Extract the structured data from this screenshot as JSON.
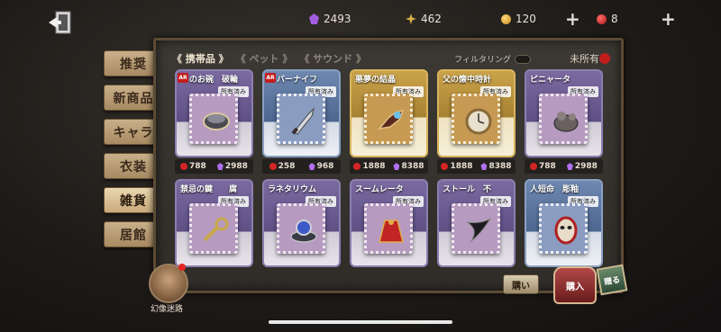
{
  "topbar": {
    "gems": "2493",
    "clues": "462",
    "coins": "120",
    "fragments": "8",
    "plus": "+"
  },
  "side_tabs": [
    "推奨",
    "新商品",
    "キャラ",
    "衣装",
    "雑貨",
    "居館"
  ],
  "active_side_tab": 4,
  "panel": {
    "cat_tabs": [
      "《 携帯品 》",
      "《 ペット 》",
      "《 サウンド 》"
    ],
    "active_cat_tab": 0,
    "filter_label": "フィルタリング",
    "unowned_label": "未所有"
  },
  "items": [
    {
      "name": "のお碗　破輪",
      "owned": "所有済み",
      "red": "788",
      "purple": "2988",
      "ar": "AR",
      "rarity": "purple"
    },
    {
      "name": "バーナイフ",
      "owned": "所有済み",
      "red": "258",
      "purple": "968",
      "ar": "AR",
      "rarity": "blue"
    },
    {
      "name": "悪夢の結晶",
      "owned": "所有済み",
      "red": "1888",
      "purple": "8388",
      "ar": "",
      "rarity": "gold"
    },
    {
      "name": "父の懐中時計",
      "owned": "所有済み",
      "red": "1888",
      "purple": "8388",
      "ar": "",
      "rarity": "gold"
    },
    {
      "name": "ピニャータ",
      "owned": "所有済み",
      "red": "788",
      "purple": "2988",
      "ar": "",
      "rarity": "purple"
    },
    {
      "name": "禁忌の鍵　　腐",
      "owned": "所有済み",
      "red": "",
      "purple": "",
      "ar": "",
      "rarity": "purple"
    },
    {
      "name": "ラネタリウム",
      "owned": "所有済み",
      "red": "",
      "purple": "",
      "ar": "",
      "rarity": "purple"
    },
    {
      "name": "スームレータ",
      "owned": "所有済み",
      "red": "",
      "purple": "",
      "ar": "",
      "rarity": "purple"
    },
    {
      "name": "ストール　不",
      "owned": "所有済み",
      "red": "",
      "purple": "",
      "ar": "",
      "rarity": "purple"
    },
    {
      "name": "人短命　彫釉",
      "owned": "所有済み",
      "red": "",
      "purple": "",
      "ar": "",
      "rarity": "blue"
    }
  ],
  "bottom": {
    "maze_label": "幻像迷路",
    "buy_small_label": "購い",
    "bag_label": "購入",
    "cart_label": "贈る"
  }
}
